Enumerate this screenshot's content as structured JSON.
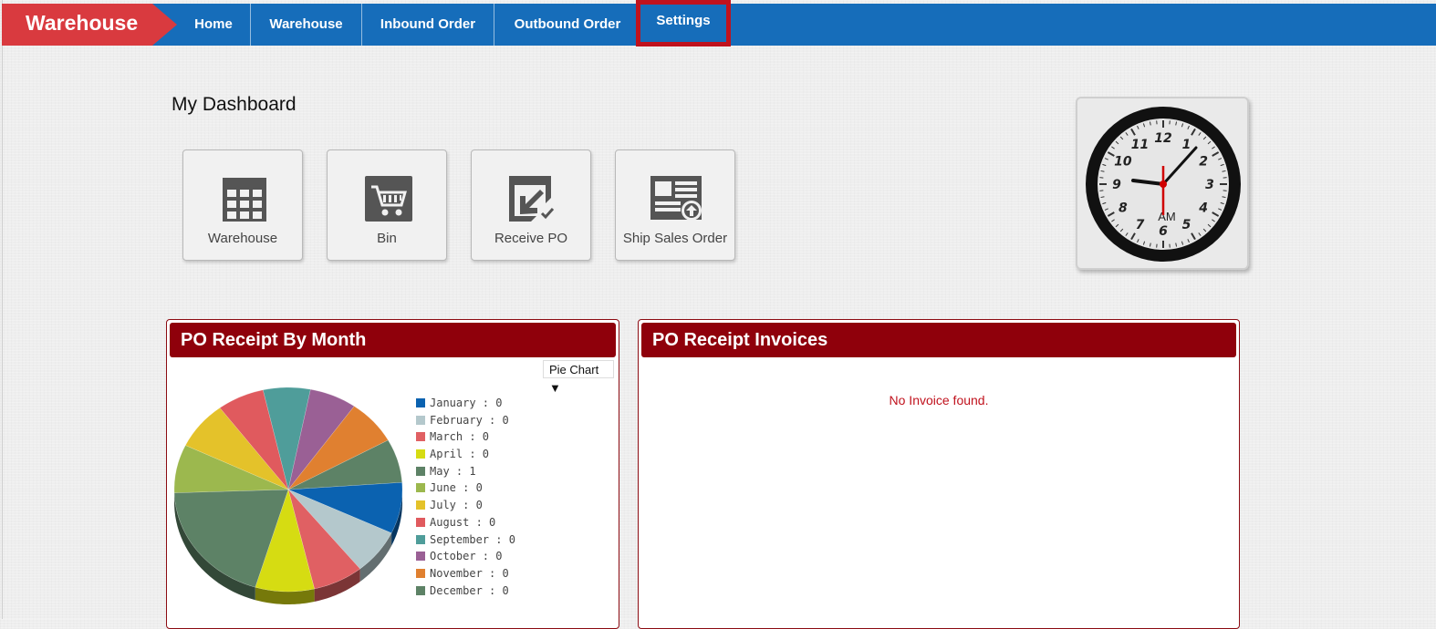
{
  "brand": "Warehouse",
  "nav": {
    "items": [
      {
        "label": "Home"
      },
      {
        "label": "Warehouse"
      },
      {
        "label": "Inbound Order"
      },
      {
        "label": "Outbound Order"
      },
      {
        "label": "Settings"
      }
    ]
  },
  "dashboard": {
    "title": "My Dashboard",
    "tiles": [
      {
        "label": "Warehouse",
        "icon": "table-grid-icon"
      },
      {
        "label": "Bin",
        "icon": "shopping-cart-icon"
      },
      {
        "label": "Receive PO",
        "icon": "receive-check-icon"
      },
      {
        "label": "Ship Sales Order",
        "icon": "ship-upload-icon"
      }
    ]
  },
  "clock": {
    "period": "AM",
    "numerals": [
      "12",
      "1",
      "2",
      "3",
      "4",
      "5",
      "6",
      "7",
      "8",
      "9",
      "10",
      "11"
    ]
  },
  "panel_po_month": {
    "title": "PO Receipt By Month",
    "chart_type_select": "Pie Chart ▼"
  },
  "panel_po_invoices": {
    "title": "PO Receipt Invoices",
    "empty_message": "No Invoice found."
  },
  "chart_data": {
    "type": "pie",
    "categories": [
      "January",
      "February",
      "March",
      "April",
      "May",
      "June",
      "July",
      "August",
      "September",
      "October",
      "November",
      "December"
    ],
    "values": [
      0,
      0,
      0,
      0,
      1,
      0,
      0,
      0,
      0,
      0,
      0,
      0
    ],
    "legend_text": [
      "January : 0",
      "February : 0",
      "March : 0",
      "April : 0",
      "May : 1",
      "June : 0",
      "July : 0",
      "August : 0",
      "September : 0",
      "October : 0",
      "November : 0",
      "December : 0"
    ],
    "colors": [
      "#0b62b0",
      "#b4c8cc",
      "#e06063",
      "#d6dc12",
      "#5d8266",
      "#9cb84e",
      "#e4c22a",
      "#e05a5e",
      "#4f9d9a",
      "#9a6095",
      "#e08030",
      "#5d8266"
    ],
    "legend_position": "right"
  },
  "colors": {
    "nav_blue": "#166dba",
    "brand_red": "#d93a3f",
    "panel_header": "#8f000b",
    "highlight": "#c0121d"
  }
}
